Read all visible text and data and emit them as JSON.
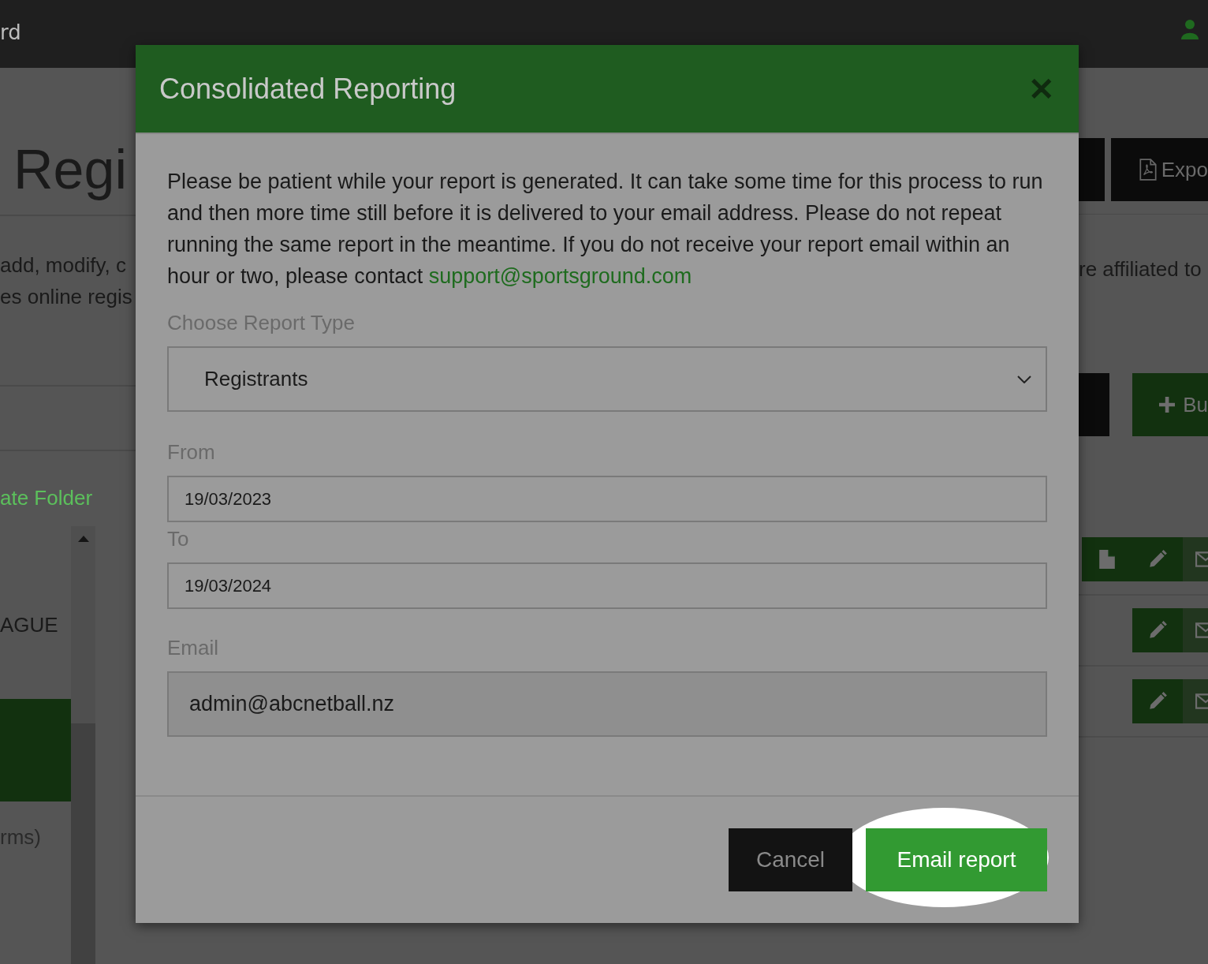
{
  "header": {
    "title_fragment": "rd"
  },
  "background": {
    "left": {
      "heading": "Regi",
      "text_lines": [
        "add, modify, c",
        "es online regis"
      ],
      "folder_link": "ate Folder",
      "list_item": "AGUE",
      "note": "rms)"
    },
    "right": {
      "export_button": "Expo",
      "text_line": "re affiliated to",
      "add_button": "Bu",
      "action_rows": [
        {
          "kind": "file-edit"
        },
        {
          "kind": "edit"
        },
        {
          "kind": "edit"
        }
      ]
    }
  },
  "modal": {
    "title": "Consolidated Reporting",
    "close": "✕",
    "message": "Please be patient while your report is generated. It can take some time for this process to run and then more time still before it is delivered to your email address. Please do not repeat running the same report in the meantime. If you do not receive your report email within an hour or two, please contact ",
    "support_email": "support@sportsground.com",
    "report_type": {
      "label": "Choose Report Type",
      "value": "Registrants"
    },
    "from": {
      "label": "From",
      "value": "19/03/2023"
    },
    "to": {
      "label": "To",
      "value": "19/03/2024"
    },
    "email": {
      "label": "Email",
      "value": "admin@abcnetball.nz"
    },
    "buttons": [
      {
        "label": "Cancel",
        "kind": "secondary",
        "highlighted": false
      },
      {
        "label": "Email report",
        "kind": "primary",
        "highlighted": true
      }
    ]
  }
}
